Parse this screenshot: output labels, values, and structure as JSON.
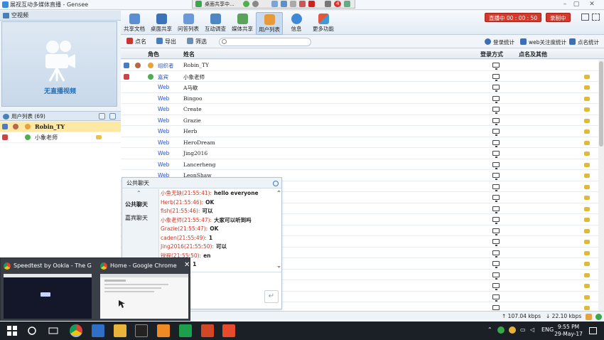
{
  "window": {
    "title": "展视互动多媒体直播 - Gensee"
  },
  "sharebar": {
    "label": "桌面共享中...",
    "badge": "4"
  },
  "video": {
    "header": "空视频",
    "no_video": "无直播视频"
  },
  "toolbar": {
    "buttons": [
      "共享文档",
      "桌面共享",
      "问答列表",
      "互动调查",
      "媒体共享",
      "用户列表",
      "信息",
      "更多功能"
    ],
    "live_btn": "直播中 00 : 00 : 50",
    "rec_btn": "录制中"
  },
  "subbar": {
    "rollcall": "点名",
    "export": "导出",
    "filter": "筛选",
    "search_placeholder": "",
    "login_stats": "登录统计",
    "web_attention": "web关注度统计",
    "rollcall_stats": "点名统计"
  },
  "userlist": {
    "header": "用户列表 (69)",
    "rows": [
      {
        "name": "Robin_TY",
        "selected": true
      },
      {
        "name": "小象老师",
        "selected": false
      }
    ]
  },
  "table": {
    "headers": {
      "role": "角色",
      "name": "姓名",
      "login": "登录方式",
      "rollcall": "点名及其他"
    },
    "rows": [
      {
        "role": "组织者",
        "name": "Robin_TY",
        "mic": false
      },
      {
        "role": "嘉宾",
        "name": "小象老师",
        "mic": true
      },
      {
        "role": "Web",
        "name": "A马歇",
        "mic": true
      },
      {
        "role": "Web",
        "name": "Bingoo",
        "mic": true
      },
      {
        "role": "Web",
        "name": "Create",
        "mic": true
      },
      {
        "role": "Web",
        "name": "Grazie",
        "mic": true
      },
      {
        "role": "Web",
        "name": "Herb",
        "mic": true
      },
      {
        "role": "Web",
        "name": "HeroDream",
        "mic": true
      },
      {
        "role": "Web",
        "name": "Jing2016",
        "mic": true
      },
      {
        "role": "Web",
        "name": "Lancerheng",
        "mic": true
      },
      {
        "role": "Web",
        "name": "LeonShaw",
        "mic": true
      },
      {
        "role": "",
        "name": "",
        "mic": true
      },
      {
        "role": "",
        "name": "",
        "mic": true
      },
      {
        "role": "",
        "name": "",
        "mic": true
      },
      {
        "role": "",
        "name": "",
        "mic": true
      },
      {
        "role": "",
        "name": "",
        "mic": true
      },
      {
        "role": "",
        "name": "",
        "mic": true
      },
      {
        "role": "",
        "name": "",
        "mic": true
      },
      {
        "role": "",
        "name": "",
        "mic": true
      },
      {
        "role": "",
        "name": "",
        "mic": true
      },
      {
        "role": "",
        "name": "",
        "mic": true
      },
      {
        "role": "",
        "name": "",
        "mic": true
      },
      {
        "role": "",
        "name": "",
        "mic": true
      }
    ]
  },
  "chat": {
    "title": "公共聊天",
    "tabs": [
      "公共聊天",
      "嘉宾聊天"
    ],
    "messages": [
      {
        "who": "小鱼无缺(21:55:41):",
        "text": "hello everyone"
      },
      {
        "who": "Herb(21:55:46):",
        "text": "OK"
      },
      {
        "who": "fish(21:55:46):",
        "text": "可以"
      },
      {
        "who": "小象老师(21:55:47):",
        "text": "大家可以听到吗"
      },
      {
        "who": "Grazie(21:55:47):",
        "text": "OK"
      },
      {
        "who": "caden(21:55:49):",
        "text": "1"
      },
      {
        "who": "Jing2016(21:55:50):",
        "text": "可以"
      },
      {
        "who": "锐程(21:55:50):",
        "text": "en"
      },
      {
        "who": "(21:55:51):",
        "text": "1"
      }
    ],
    "send": "↵"
  },
  "status": {
    "up": "↑ 107.04 kbps",
    "down": "↓ 22.10 kbps"
  },
  "thumbnails": [
    {
      "title": "Speedtest by Ookla - The Globa..."
    },
    {
      "title": "Home - Google Chrome"
    }
  ],
  "taskbar": {
    "lang": "ENG",
    "time": "9:55 PM",
    "date": "29-May-17"
  }
}
